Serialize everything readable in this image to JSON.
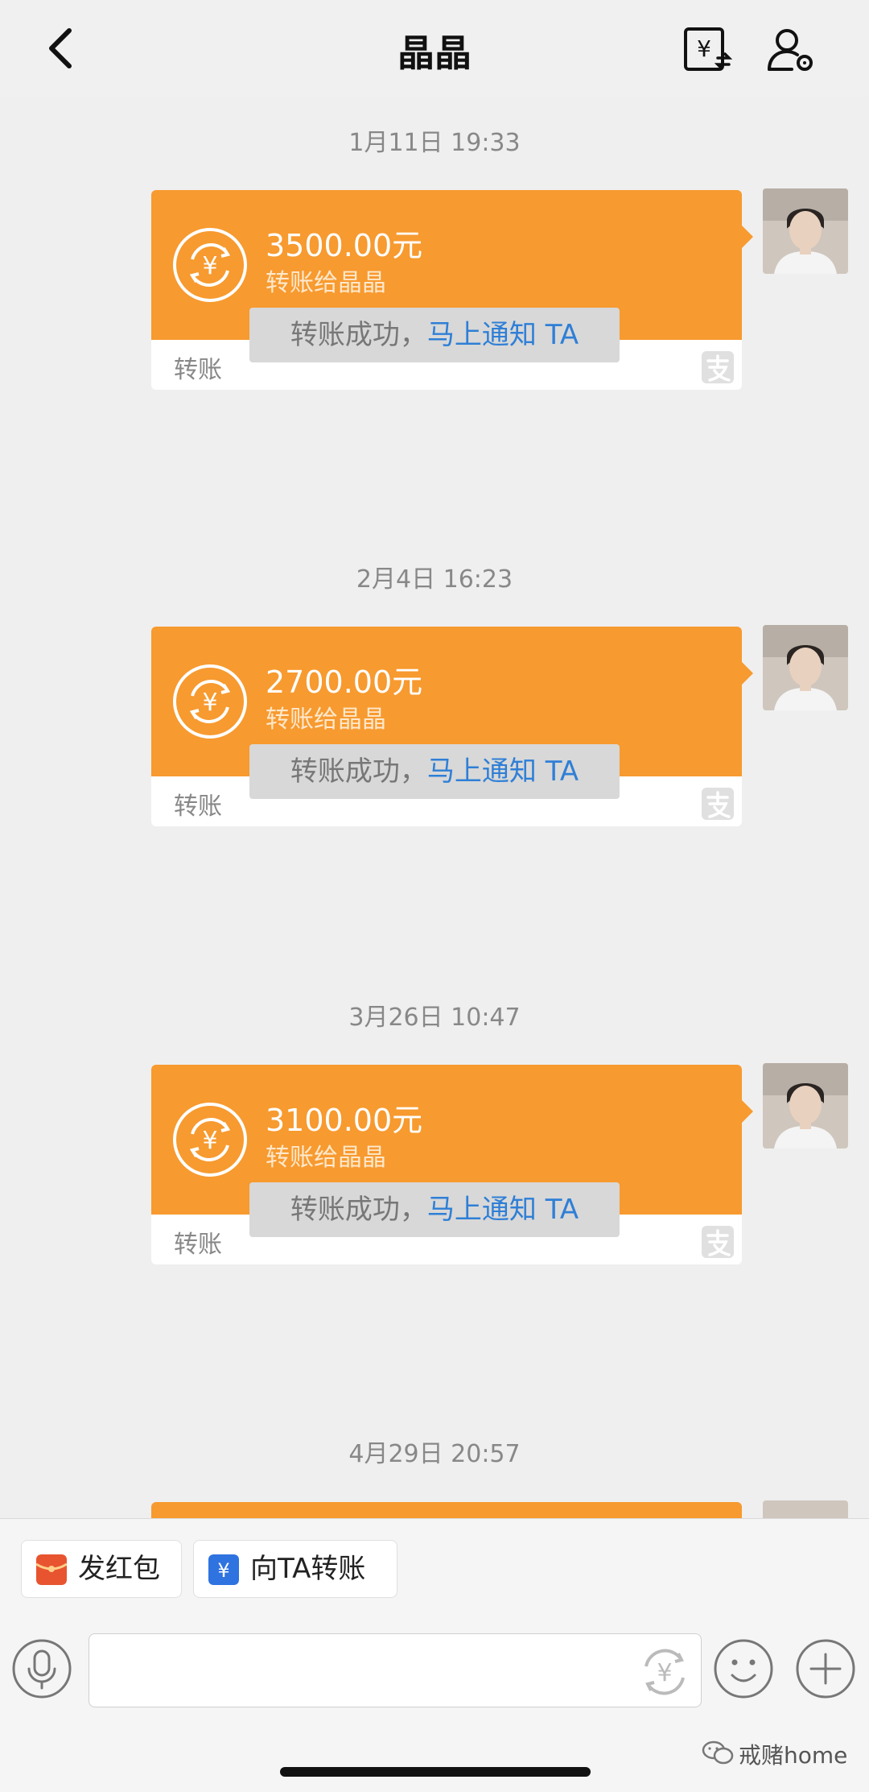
{
  "header": {
    "title": "晶晶",
    "back_icon": "chevron-left-icon",
    "transfer_record_icon": "yuan-exchange-icon",
    "settings_icon": "user-settings-icon"
  },
  "messages": [
    {
      "time": "1月11日 19:33",
      "amount": "3500.00元",
      "to": "转账给晶晶",
      "label": "转账",
      "notice_prefix": "转账成功，",
      "notice_link": "马上通知 TA"
    },
    {
      "time": "2月4日 16:23",
      "amount": "2700.00元",
      "to": "转账给晶晶",
      "label": "转账",
      "notice_prefix": "转账成功，",
      "notice_link": "马上通知 TA"
    },
    {
      "time": "3月26日 10:47",
      "amount": "3100.00元",
      "to": "转账给晶晶",
      "label": "转账",
      "notice_prefix": "转账成功，",
      "notice_link": "马上通知 TA"
    },
    {
      "time": "4月29日 20:57"
    }
  ],
  "quick_actions": {
    "red_packet": "发红包",
    "transfer": "向TA转账"
  },
  "input": {
    "placeholder": ""
  },
  "watermark": "戒赌home",
  "colors": {
    "card_orange": "#f79a2f",
    "link_blue": "#2f7fd6",
    "red_packet": "#e8542f",
    "transfer_blue": "#2f73e0"
  }
}
